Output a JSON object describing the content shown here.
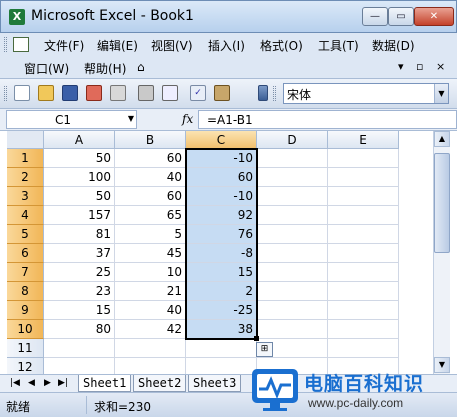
{
  "window": {
    "title": "Microsoft Excel - Book1",
    "minimize_glyph": "—",
    "maximize_glyph": "▭",
    "close_glyph": "✕"
  },
  "menu": {
    "row1": [
      "文件(F)",
      "编辑(E)",
      "视图(V)",
      "插入(I)",
      "格式(O)",
      "工具(T)",
      "数据(D)"
    ],
    "row2": [
      "窗口(W)",
      "帮助(H)"
    ],
    "mdi": [
      "▾",
      "▫",
      "×"
    ]
  },
  "toolbar": {
    "font_name": "宋体"
  },
  "formula_bar": {
    "cell_ref": "C1",
    "fx_label": "fx",
    "formula": "=A1-B1"
  },
  "grid": {
    "columns": [
      "A",
      "B",
      "C",
      "D",
      "E"
    ],
    "selected_column": "C",
    "rows": [
      {
        "num": "1",
        "a": "50",
        "b": "60",
        "c": "-10"
      },
      {
        "num": "2",
        "a": "100",
        "b": "40",
        "c": "60"
      },
      {
        "num": "3",
        "a": "50",
        "b": "60",
        "c": "-10"
      },
      {
        "num": "4",
        "a": "157",
        "b": "65",
        "c": "92"
      },
      {
        "num": "5",
        "a": "81",
        "b": "5",
        "c": "76"
      },
      {
        "num": "6",
        "a": "37",
        "b": "45",
        "c": "-8"
      },
      {
        "num": "7",
        "a": "25",
        "b": "10",
        "c": "15"
      },
      {
        "num": "8",
        "a": "23",
        "b": "21",
        "c": "2"
      },
      {
        "num": "9",
        "a": "15",
        "b": "40",
        "c": "-25"
      },
      {
        "num": "10",
        "a": "80",
        "b": "42",
        "c": "38"
      },
      {
        "num": "11",
        "a": "",
        "b": "",
        "c": ""
      },
      {
        "num": "12",
        "a": "",
        "b": "",
        "c": ""
      }
    ]
  },
  "sheets": {
    "tabs": [
      "Sheet1",
      "Sheet2",
      "Sheet3"
    ],
    "active": "Sheet1",
    "nav": [
      "|◀",
      "◀",
      "▶",
      "▶|"
    ]
  },
  "status": {
    "ready": "就绪",
    "sum": "求和=230"
  },
  "watermark": {
    "title": "电脑百科知识",
    "url": "www.pc-daily.com"
  },
  "colors": {
    "selection_fill": "#c6dcf3",
    "header_selected": "#f2c06e",
    "brand_blue": "#1a6fd0"
  }
}
